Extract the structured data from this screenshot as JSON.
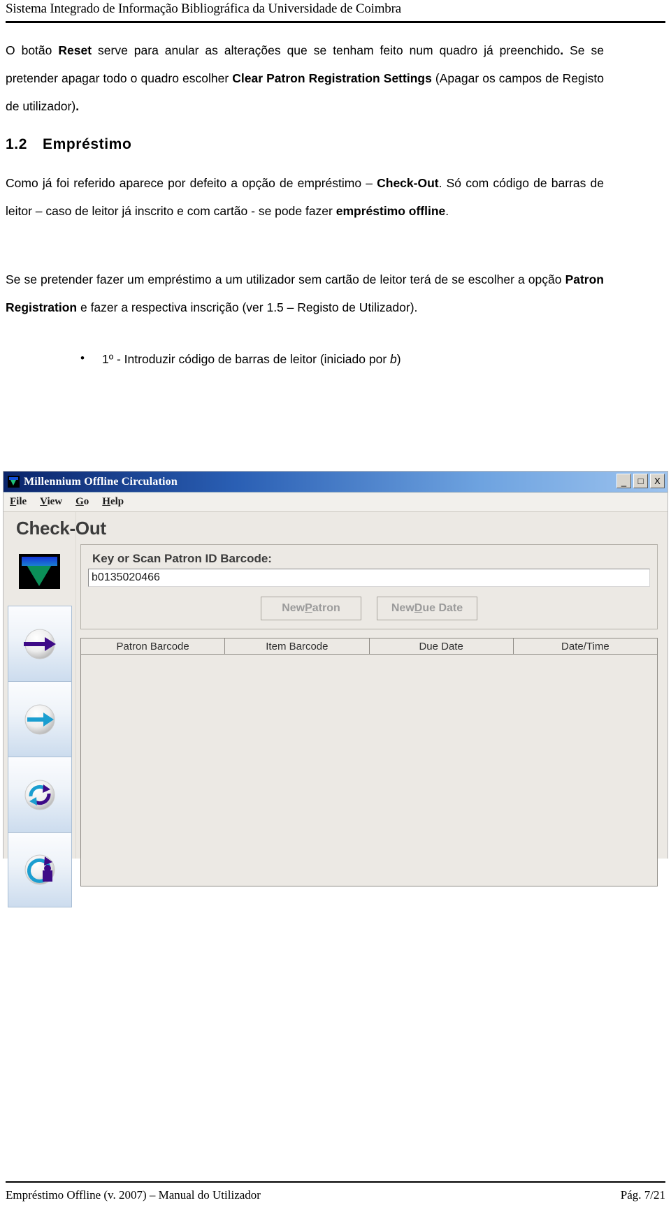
{
  "header": {
    "title": "Sistema Integrado de Informação Bibliográfica da Universidade de Coimbra"
  },
  "content": {
    "para1": {
      "t1": "O botão ",
      "b1": "Reset",
      "t2": " serve para anular as alterações que se tenham feito num quadro já preenchido",
      "b2": ".",
      "t3": " Se se pretender apagar todo o quadro escolher ",
      "b3": "Clear Patron Registration Settings",
      "t4": " (Apagar os campos de Registo de utilizador)",
      "b4": "."
    },
    "section": {
      "number": "1.2",
      "title": "Empréstimo"
    },
    "para2": {
      "t1": "Como já foi referido aparece por defeito a opção de empréstimo – ",
      "b1": "Check-Out",
      "t2": ". Só com código de barras de leitor – caso de leitor já inscrito e com cartão - se pode fazer ",
      "b2": "empréstimo offline",
      "t3": "."
    },
    "para3": {
      "t1": "Se se pretender fazer um empréstimo a um utilizador sem cartão de leitor terá de se escolher a opção ",
      "b1": "Patron Registration",
      "t2": " e fazer a respectiva inscrição (ver 1.5 – Registo de Utilizador)."
    },
    "bullets": [
      {
        "t1": "1º - Introduzir código de barras de leitor (iniciado por ",
        "i1": "b",
        "t2": ")"
      }
    ]
  },
  "app": {
    "window_title": "Millennium Offline Circulation",
    "window_icon": "millennium-triangle-icon",
    "window_buttons": {
      "minimize": "_",
      "maximize": "□",
      "close": "X"
    },
    "menu": [
      {
        "pre": "",
        "key": "F",
        "post": "ile"
      },
      {
        "pre": "",
        "key": "V",
        "post": "iew"
      },
      {
        "pre": "",
        "key": "G",
        "post": "o"
      },
      {
        "pre": "",
        "key": "H",
        "post": "elp"
      }
    ],
    "page_heading": "Check-Out",
    "rail": {
      "logo_name": "millennium-logo",
      "buttons": [
        {
          "icon": "check-out-arrow-icon",
          "accent": "#3d0a87"
        },
        {
          "icon": "check-in-arrow-icon",
          "accent": "#1b9ed0"
        },
        {
          "icon": "renew-circular-arrows-icon",
          "accent": "#1b9ed0"
        },
        {
          "icon": "patron-registration-icon",
          "accent": "#1b9ed0"
        }
      ]
    },
    "form": {
      "field_label": "Key or Scan Patron ID Barcode:",
      "barcode_value": "b0135020466",
      "barcode_placeholder": "",
      "buttons": [
        {
          "pre": "New ",
          "key": "P",
          "post": "atron",
          "disabled": true
        },
        {
          "pre": "New ",
          "key": "D",
          "post": "ue Date",
          "disabled": true
        }
      ]
    },
    "grid": {
      "columns": [
        "Patron Barcode",
        "Item Barcode",
        "Due Date",
        "Date/Time"
      ],
      "rows": []
    }
  },
  "footer": {
    "left": "Empréstimo Offline (v. 2007) – Manual do Utilizador",
    "right": "Pág. 7/21"
  },
  "colors": {
    "titlebar_start": "#0a246a",
    "titlebar_end": "#9dc3ee",
    "window_face": "#ece9e4",
    "rail_button": "#ccdcee",
    "logo_green": "#0b8f58",
    "logo_blue": "#1335d8"
  }
}
